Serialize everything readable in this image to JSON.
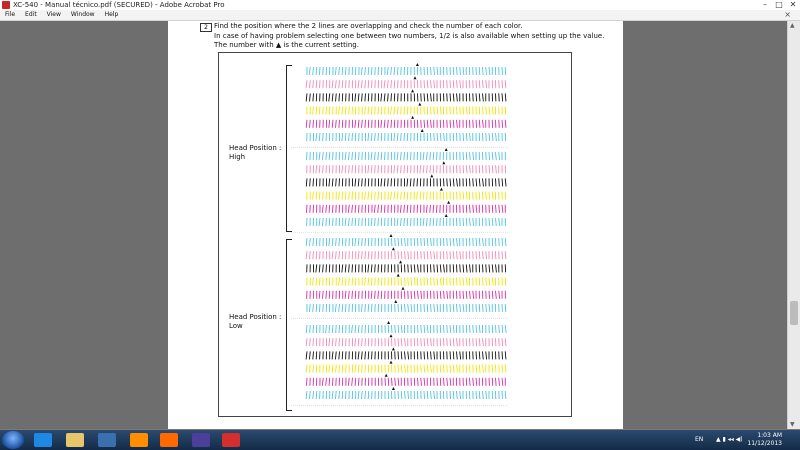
{
  "window": {
    "title": "XC-540 - Manual técnico.pdf (SECURED) - Adobe Acrobat Pro",
    "controls": [
      "–",
      "□",
      "✕"
    ]
  },
  "menu": [
    "File",
    "Edit",
    "View",
    "Window",
    "Help"
  ],
  "document": {
    "step_number": "2",
    "instructions": [
      "Find the position where the 2 lines are overlapping and check the number of each color.",
      "In case of having problem selecting one between two numbers, 1/2 is also available when setting up the value.",
      "The number with ▲ is the current setting."
    ],
    "head_high_label": [
      "Head Position :",
      "High"
    ],
    "head_low_label": [
      "Head Position :",
      "Low"
    ]
  },
  "taskbar": {
    "tray_language": "EN",
    "time": "1:03 AM",
    "date": "11/12/2013"
  },
  "colors": {
    "cyan": "#4fc3e6",
    "magenta": "#d92aa6",
    "yellow": "#f2e600",
    "black": "#111111",
    "pink": "#f08ab8"
  }
}
